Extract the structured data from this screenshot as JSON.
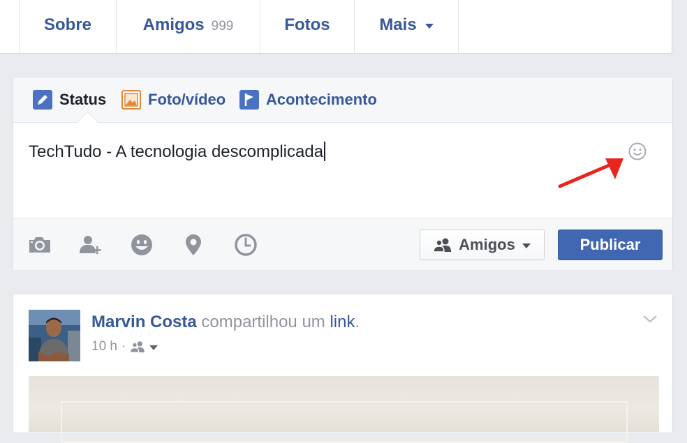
{
  "nav": {
    "tabs": [
      {
        "label": "Sobre"
      },
      {
        "label": "Amigos",
        "count": "999"
      },
      {
        "label": "Fotos"
      },
      {
        "label": "Mais"
      }
    ]
  },
  "composer": {
    "tabs": [
      {
        "label": "Status",
        "icon": "pencil-icon",
        "active": true
      },
      {
        "label": "Foto/vídeo",
        "icon": "photo-icon"
      },
      {
        "label": "Acontecimento",
        "icon": "flag-icon"
      }
    ],
    "text_value": "TechTudo - A tecnologia descomplicada",
    "toolbar_icons": [
      "camera-icon",
      "tag-friends-icon",
      "feeling-icon",
      "location-icon",
      "clock-icon"
    ],
    "audience_label": "Amigos",
    "publish_label": "Publicar"
  },
  "post": {
    "author": "Marvin Costa",
    "action_text": "compartilhou um",
    "link_text": "link",
    "period": ".",
    "time": "10 h",
    "separator": "·"
  },
  "colors": {
    "brand_blue": "#4267b2",
    "link_blue": "#365899",
    "background": "#e9ebee",
    "arrow_red": "#e8261e"
  }
}
